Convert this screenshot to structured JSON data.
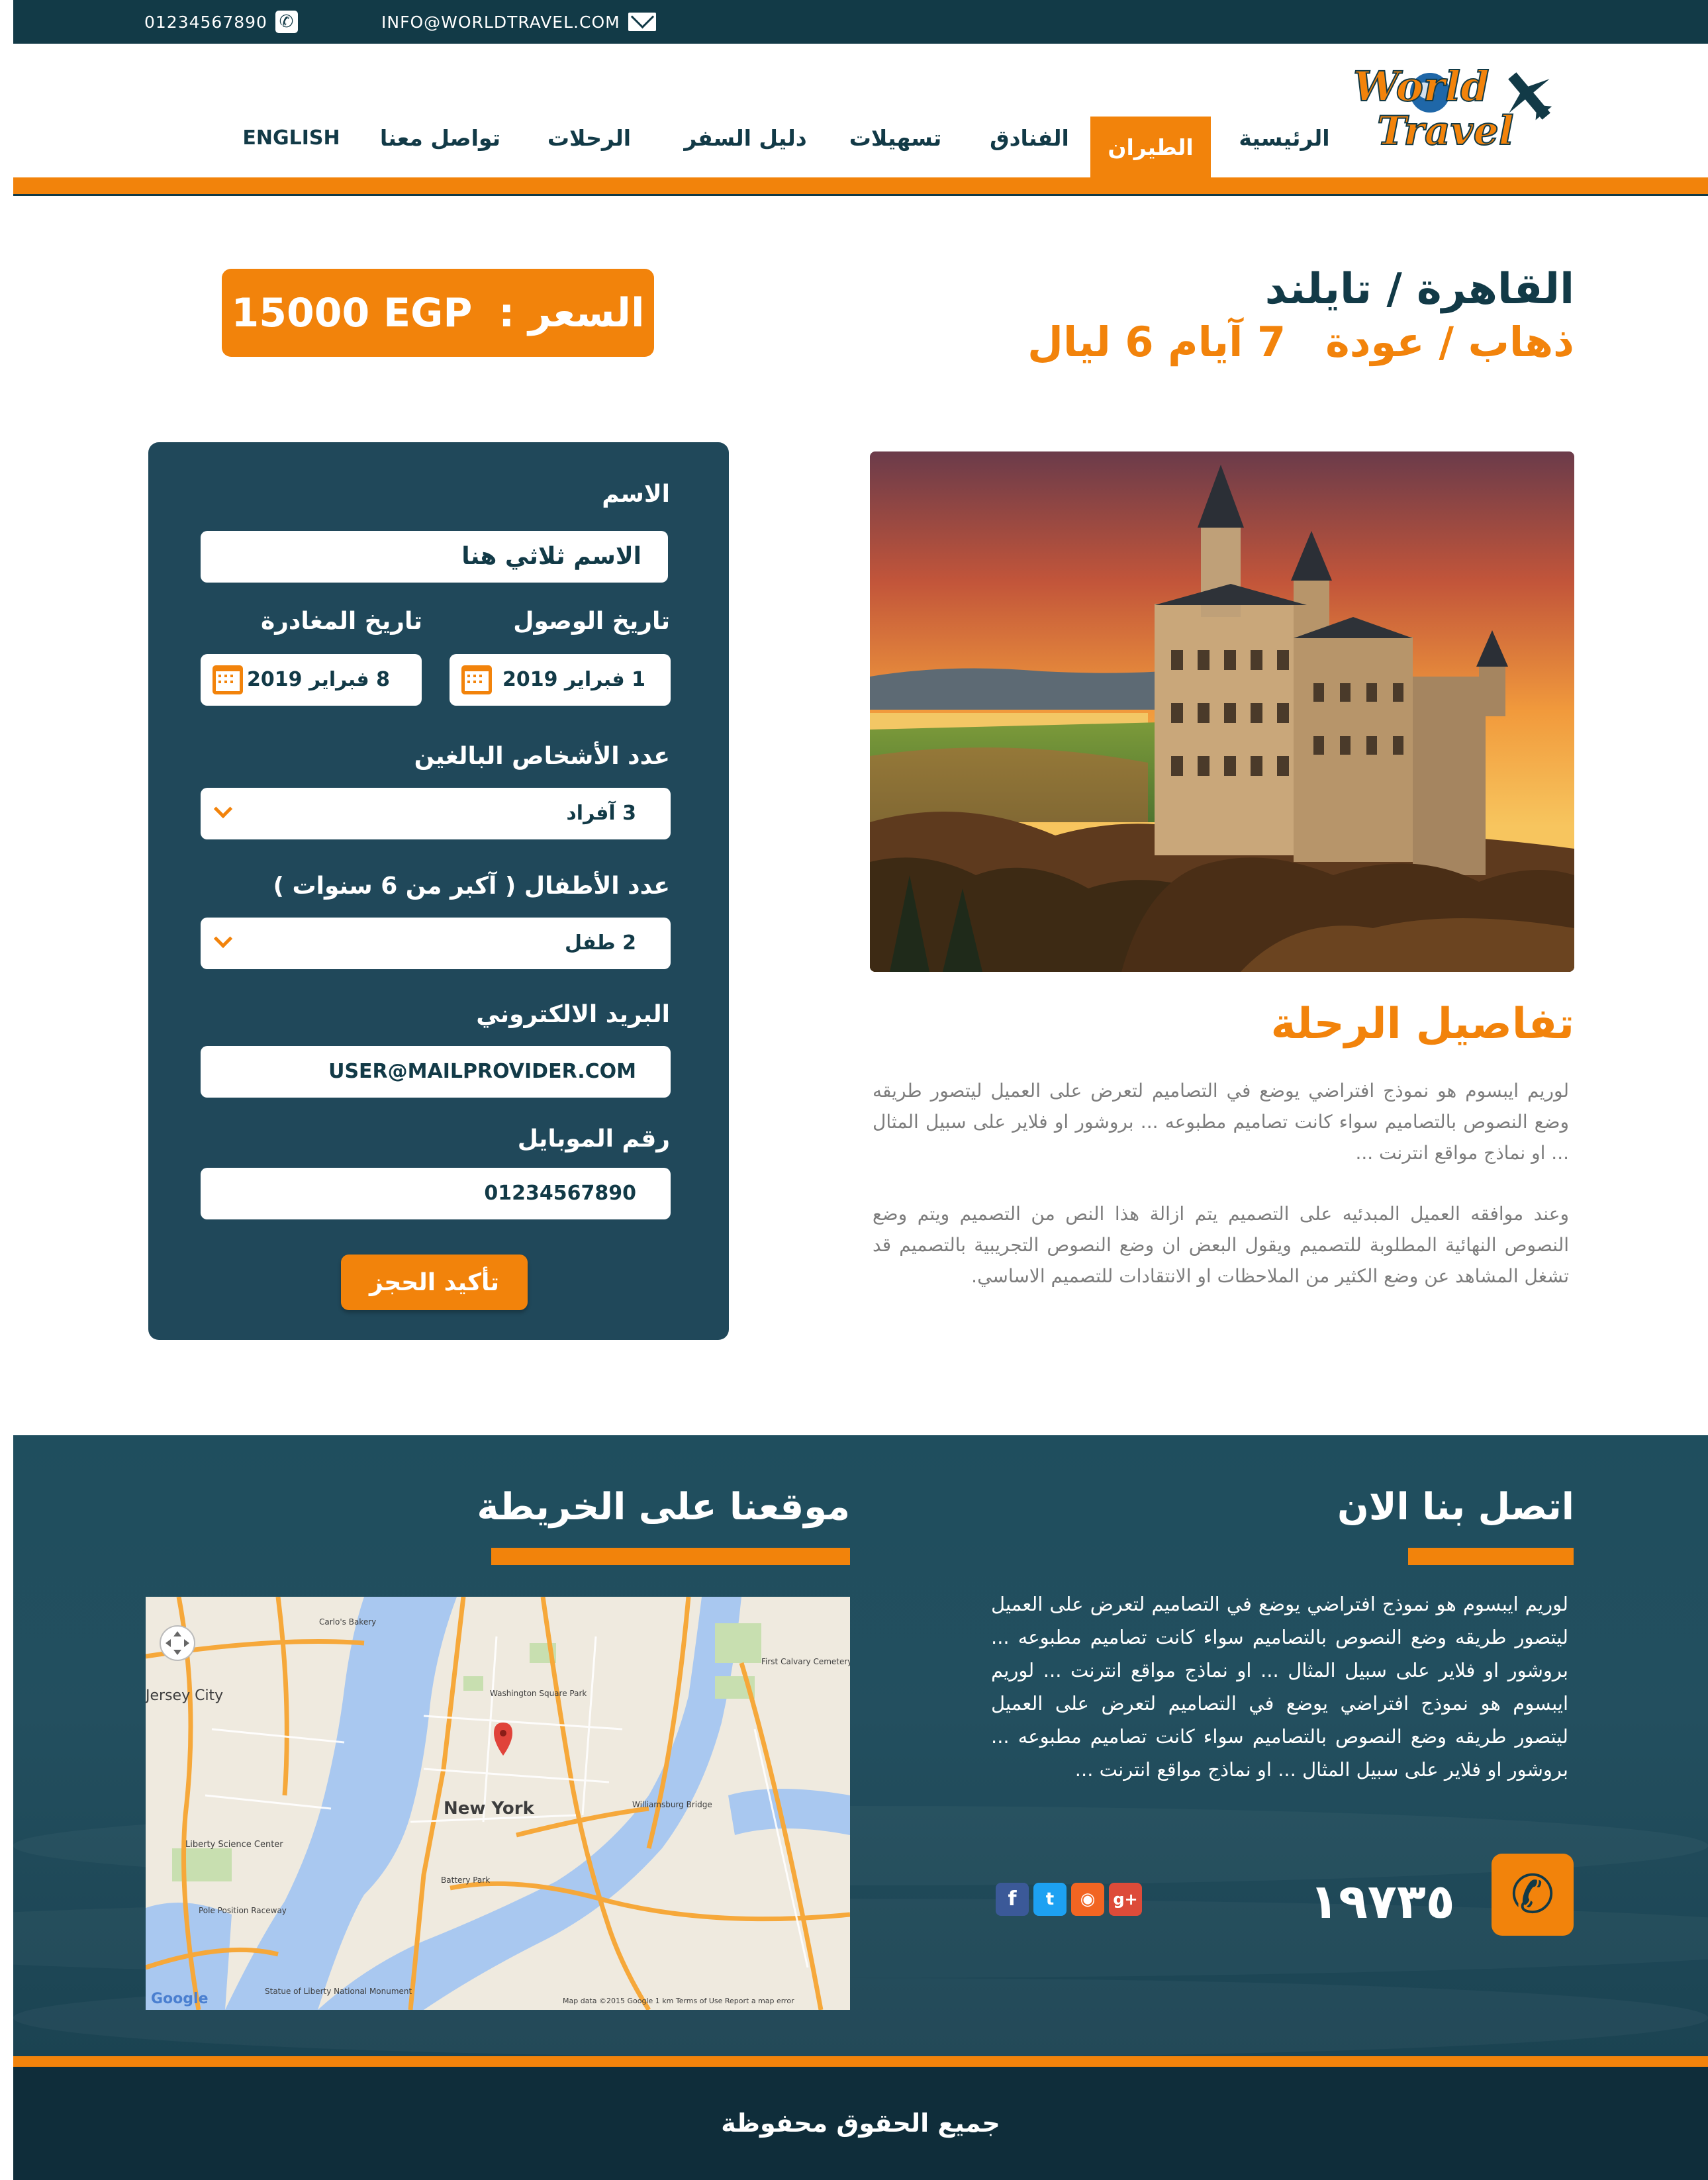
{
  "topbar": {
    "phone": "01234567890",
    "email": "INFO@WORLDTRAVEL.COM",
    "phone_icon": "phone-icon",
    "email_icon": "envelope-icon"
  },
  "logo": {
    "line1": "World",
    "line2": "Travel",
    "icon": "airplane-icon"
  },
  "nav": {
    "home": "الرئيسية",
    "flights": "الطيران",
    "hotels": "الفنادق",
    "facilities": "تسهيلات",
    "guide": "دليل السفر",
    "trips": "الرحلات",
    "contact": "تواصل معنا",
    "english": "ENGLISH",
    "active": "flights"
  },
  "offer": {
    "route": "القاهرة / تايلند",
    "trip_type": "ذهاب / عودة",
    "duration": "7 آيام 6 ليال",
    "price_label": "السعر :",
    "price_value": "15000 EGP"
  },
  "details": {
    "title": "تفاصيل الرحلة",
    "paragraph1": "لوريم ايبسوم هو نموذج افتراضي يوضع في التصاميم لتعرض على العميل ليتصور طريقه وضع النصوص بالتصاميم سواء كانت تصاميم مطبوعه ... بروشور او فلاير على سبيل المثال ... او نماذج مواقع انترنت ...",
    "paragraph2": "وعند موافقه العميل المبدئيه على التصميم يتم ازالة هذا النص من التصميم ويتم وضع النصوص النهائية المطلوبة للتصميم ويقول البعض ان وضع النصوص التجريبية بالتصميم قد تشغل المشاهد عن وضع الكثير من الملاحظات او الانتقادات للتصميم الاساسي."
  },
  "form": {
    "name_label": "الاسم",
    "name_value": "الاسم ثلاثي هنا",
    "arrival_label": "تاريخ الوصول",
    "arrival_value": "1 فبراير 2019",
    "departure_label": "تاريخ المغادرة",
    "departure_value": "8 فبراير 2019",
    "adults_label": "عدد الأشخاص البالغين",
    "adults_value": "3 آفراد",
    "children_label": "عدد الأطفال ( آكبر من 6 سنوات )",
    "children_value": "2 طفل",
    "email_label": "البريد الالكتروني",
    "email_value": "USER@MAILPROVIDER.COM",
    "mobile_label": "رقم الموبايل",
    "mobile_value": "01234567890",
    "submit": "تأكيد الحجز"
  },
  "contact": {
    "title": "اتصل بنا الان",
    "paragraph": "لوريم ايبسوم هو نموذج افتراضي يوضع في التصاميم لتعرض على العميل ليتصور طريقه وضع النصوص بالتصاميم سواء كانت تصاميم مطبوعه ... بروشور او فلاير على سبيل المثال ... او نماذج مواقع انترنت ... لوريم ايبسوم هو نموذج افتراضي يوضع في التصاميم لتعرض على العميل ليتصور طريقه وضع النصوص بالتصاميم سواء كانت تصاميم مطبوعه ... بروشور او فلاير على سبيل المثال ... او نماذج مواقع انترنت ...",
    "hotline": "١٩٧٣٥",
    "social": [
      "facebook-icon",
      "twitter-icon",
      "rss-icon",
      "google-plus-icon"
    ]
  },
  "map": {
    "title": "موقعنا على الخريطة",
    "city_label": "New York",
    "labels": {
      "jersey_city": "Jersey City",
      "williamsburg_bridge": "Williamsburg Bridge",
      "liberty_science": "Liberty Science Center",
      "battery_park": "Battery Park",
      "statue": "Statue of Liberty National Monument",
      "pole_position": "Pole Position Raceway",
      "carlos_bakery": "Carlo's Bakery",
      "washington_square": "Washington Square Park",
      "first_calvary": "First Calvary Cemetery",
      "google": "Google",
      "attribution": "Map data ©2015 Google   1 km   Terms of Use   Report a map error"
    }
  },
  "footer": {
    "copyright": "جميع الحقوق محفوظة"
  },
  "colors": {
    "primary": "#123a47",
    "accent": "#f2830b",
    "panel": "#20485a"
  }
}
